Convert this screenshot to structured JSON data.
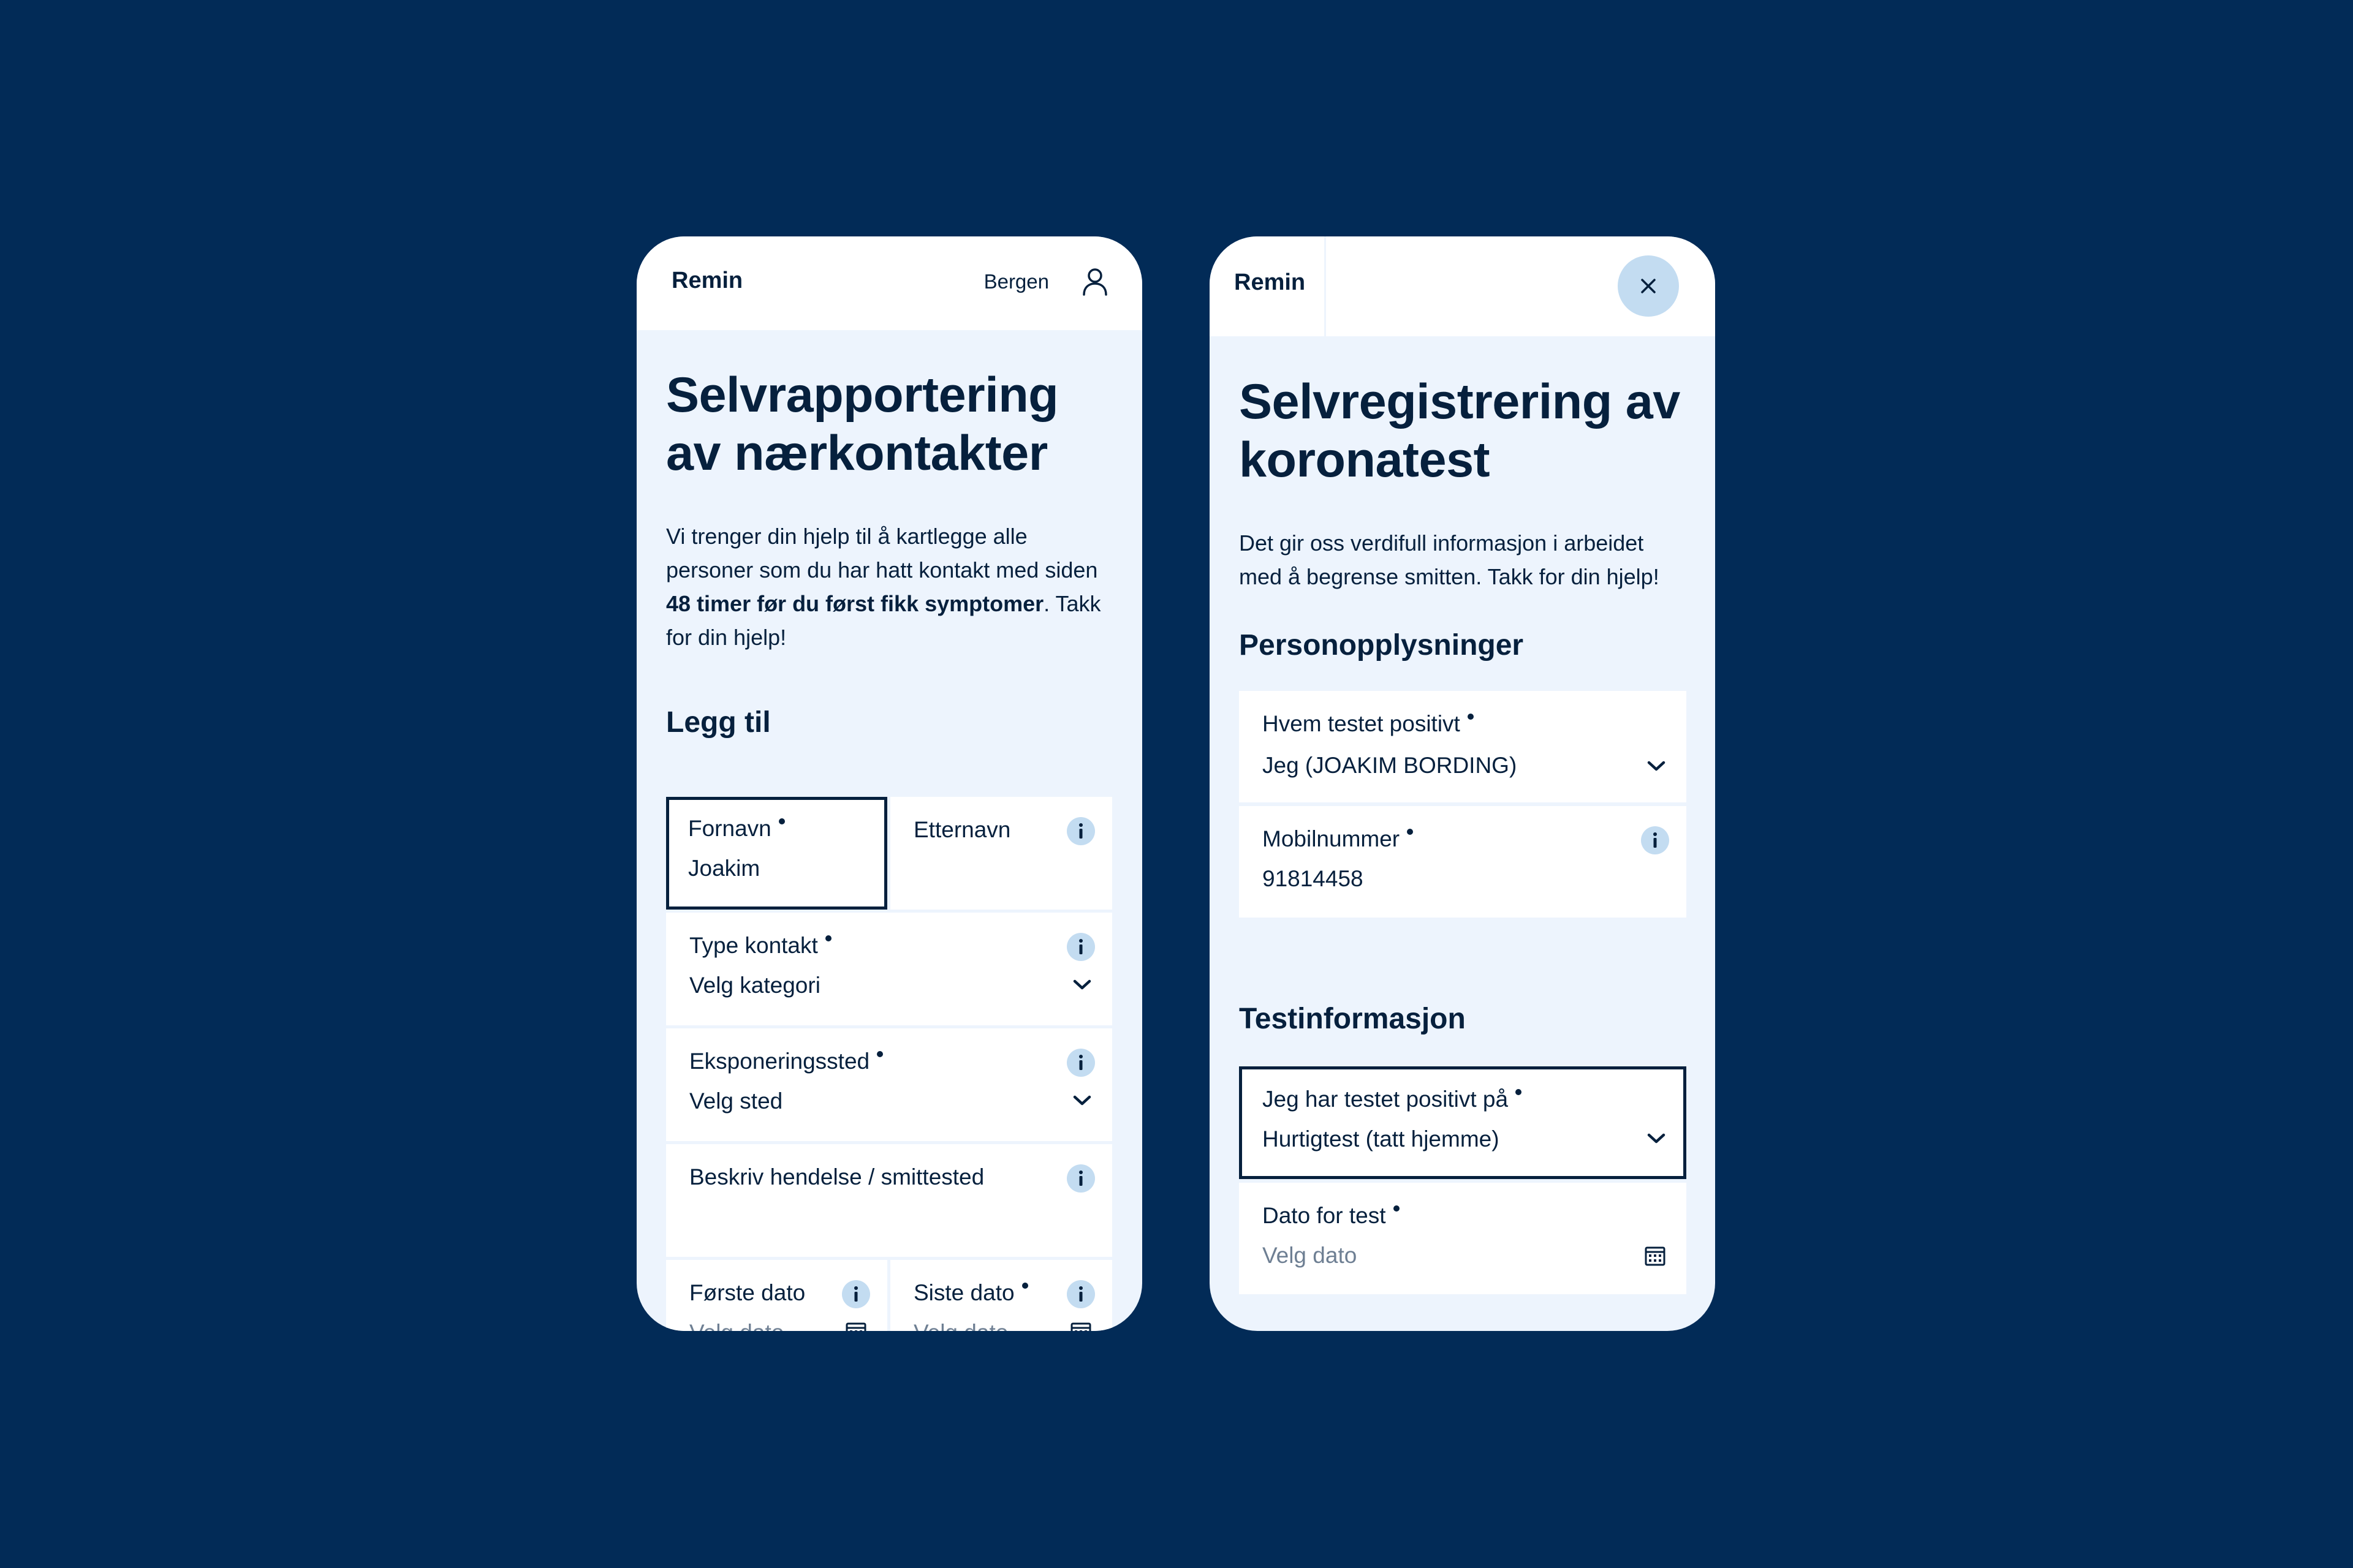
{
  "left": {
    "brand": "Remin",
    "location": "Bergen",
    "title": "Selvrapportering av nærkontakter",
    "intro_part1": "Vi trenger din hjelp til å kartlegge alle personer som du har hatt kontakt med siden ",
    "intro_bold": "48 timer før du først fikk symptomer",
    "intro_part2": ". Takk for din hjelp!",
    "section": "Legg til",
    "fields": {
      "first_name": {
        "label": "Fornavn",
        "value": "Joakim"
      },
      "last_name": {
        "label": "Etternavn"
      },
      "contact_type": {
        "label": "Type kontakt",
        "value": "Velg kategori"
      },
      "exposure": {
        "label": "Eksponeringssted",
        "value": "Velg sted"
      },
      "describe": {
        "label": "Beskriv hendelse / smittested"
      },
      "first_date": {
        "label": "Første dato",
        "value": "Velg dato"
      },
      "last_date": {
        "label": "Siste dato",
        "value": "Velg dato"
      }
    }
  },
  "right": {
    "brand": "Remin",
    "title": "Selvregistrering av koronatest",
    "intro": "Det gir oss verdifull informasjon i arbeidet med å begrense smitten. Takk for din hjelp!",
    "section_personal": "Personopplysninger",
    "section_test": "Testinformasjon",
    "fields": {
      "who_tested": {
        "label": "Hvem testet positivt",
        "value": "Jeg (JOAKIM BORDING)"
      },
      "mobile": {
        "label": "Mobilnummer",
        "value": "91814458"
      },
      "test_type": {
        "label": "Jeg har testet positivt på",
        "value": "Hurtigtest (tatt hjemme)"
      },
      "test_date": {
        "label": "Dato for test",
        "value": "Velg dato"
      }
    }
  },
  "colors": {
    "background": "#022b57",
    "panel": "#edf4fd",
    "text": "#06203d",
    "accent_light": "#c3dcf1"
  }
}
